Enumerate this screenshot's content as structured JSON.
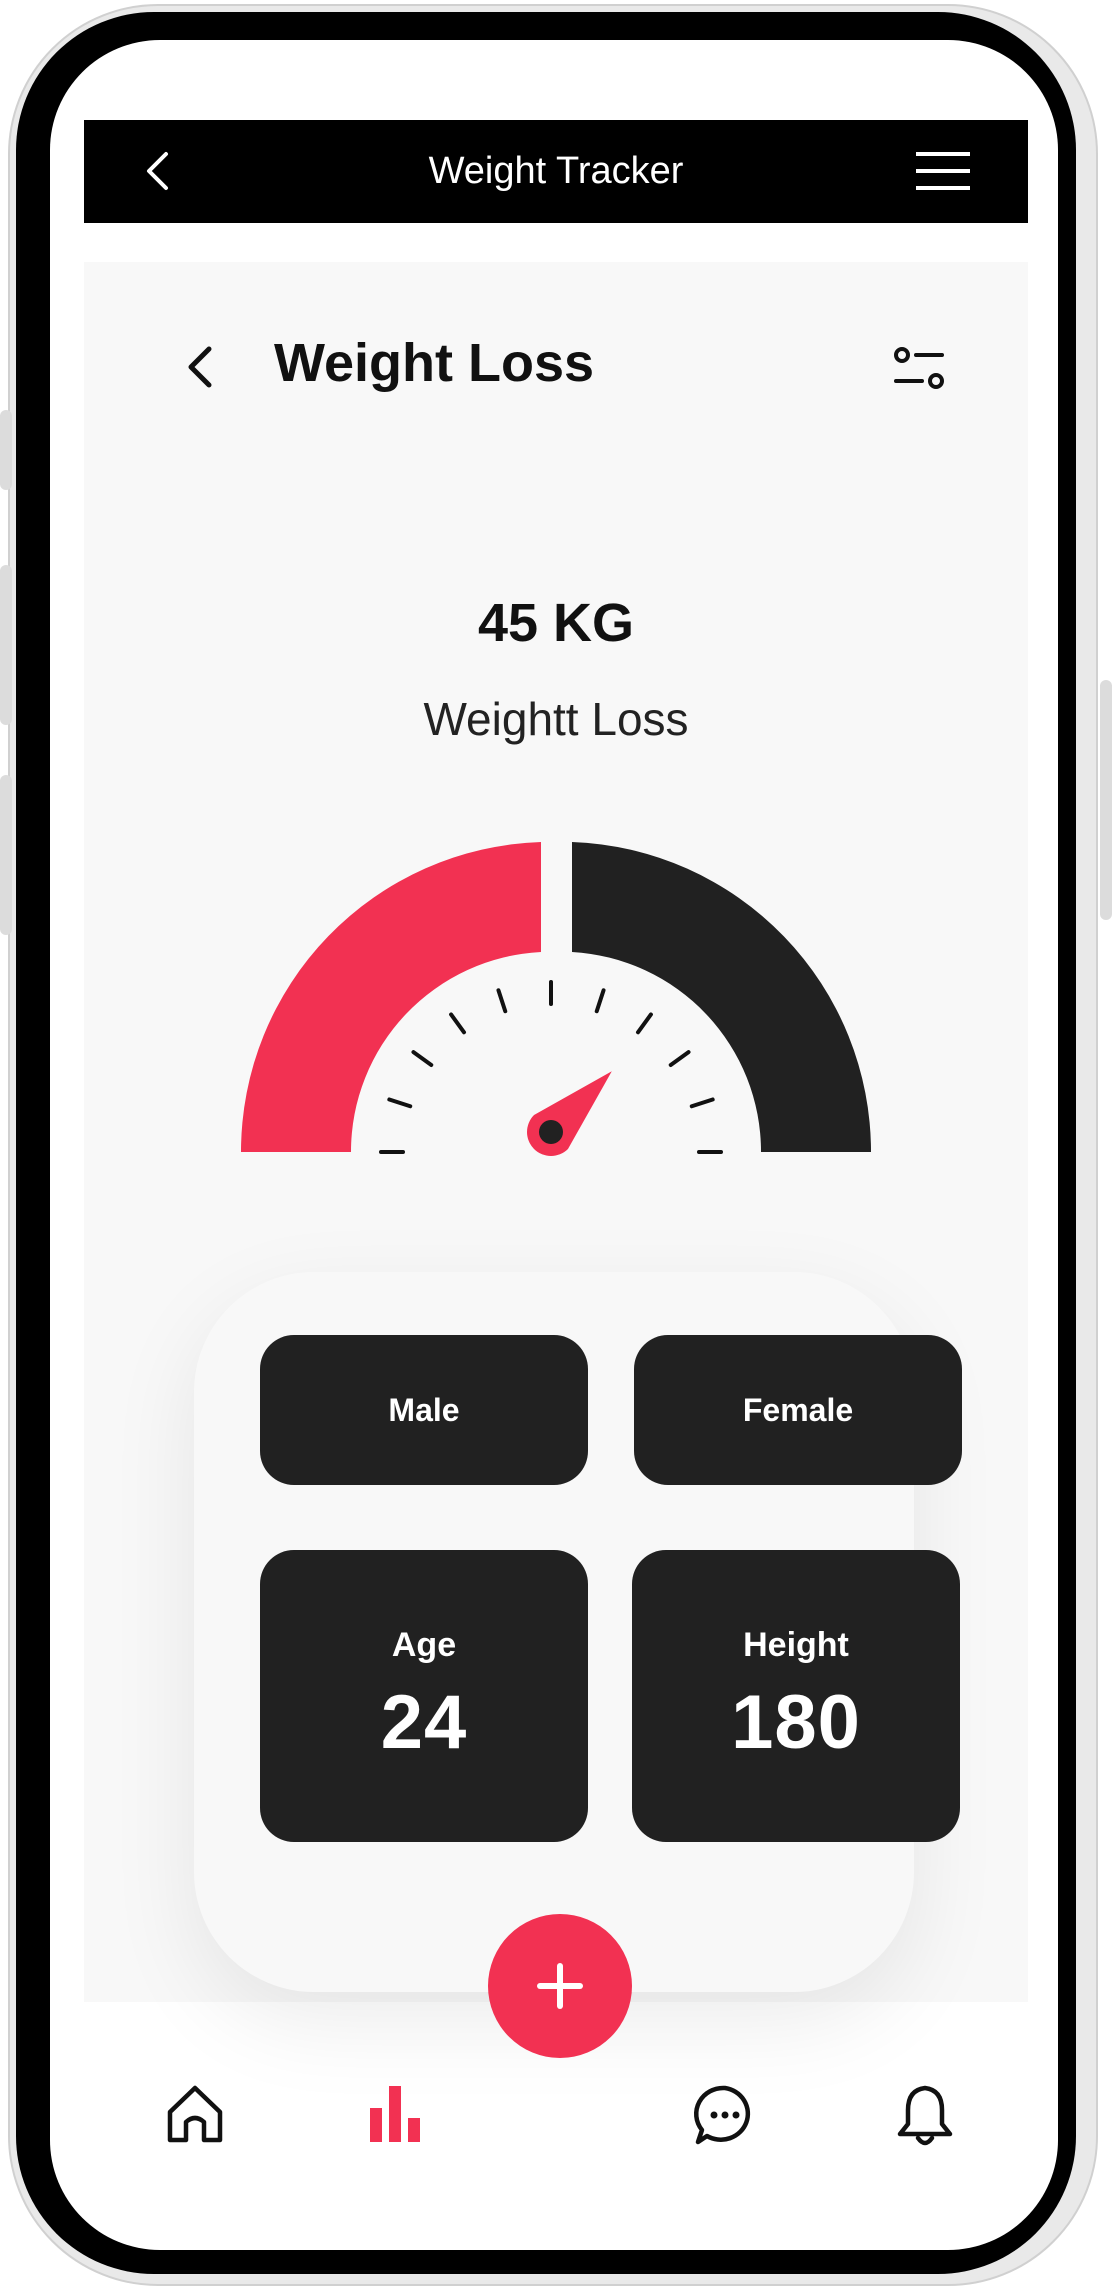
{
  "app_bar": {
    "title": "Weight Tracker",
    "back_icon": "chevron-left-icon",
    "menu_icon": "hamburger-menu-icon"
  },
  "page": {
    "title": "Weight Loss",
    "back_icon": "chevron-left-icon",
    "filter_icon": "sliders-icon"
  },
  "summary": {
    "value": "45 KG",
    "label": "Weightt Loss"
  },
  "gauge": {
    "progress_fraction": 0.5,
    "needle_level": 0.7,
    "colors": {
      "filled": "#f23152",
      "remaining": "#212121"
    }
  },
  "gender_options": [
    {
      "label": "Male"
    },
    {
      "label": "Female"
    }
  ],
  "stats": [
    {
      "label": "Age",
      "value": "24"
    },
    {
      "label": "Height",
      "value": "180"
    }
  ],
  "fab": {
    "icon": "plus-icon"
  },
  "bottom_nav": [
    {
      "icon": "home-icon",
      "active": false
    },
    {
      "icon": "bar-chart-icon",
      "active": true
    },
    {
      "icon": "chat-icon",
      "active": false
    },
    {
      "icon": "bell-icon",
      "active": false
    }
  ],
  "colors": {
    "accent": "#f23152",
    "dark": "#212121",
    "panel": "#f8f8f8"
  }
}
